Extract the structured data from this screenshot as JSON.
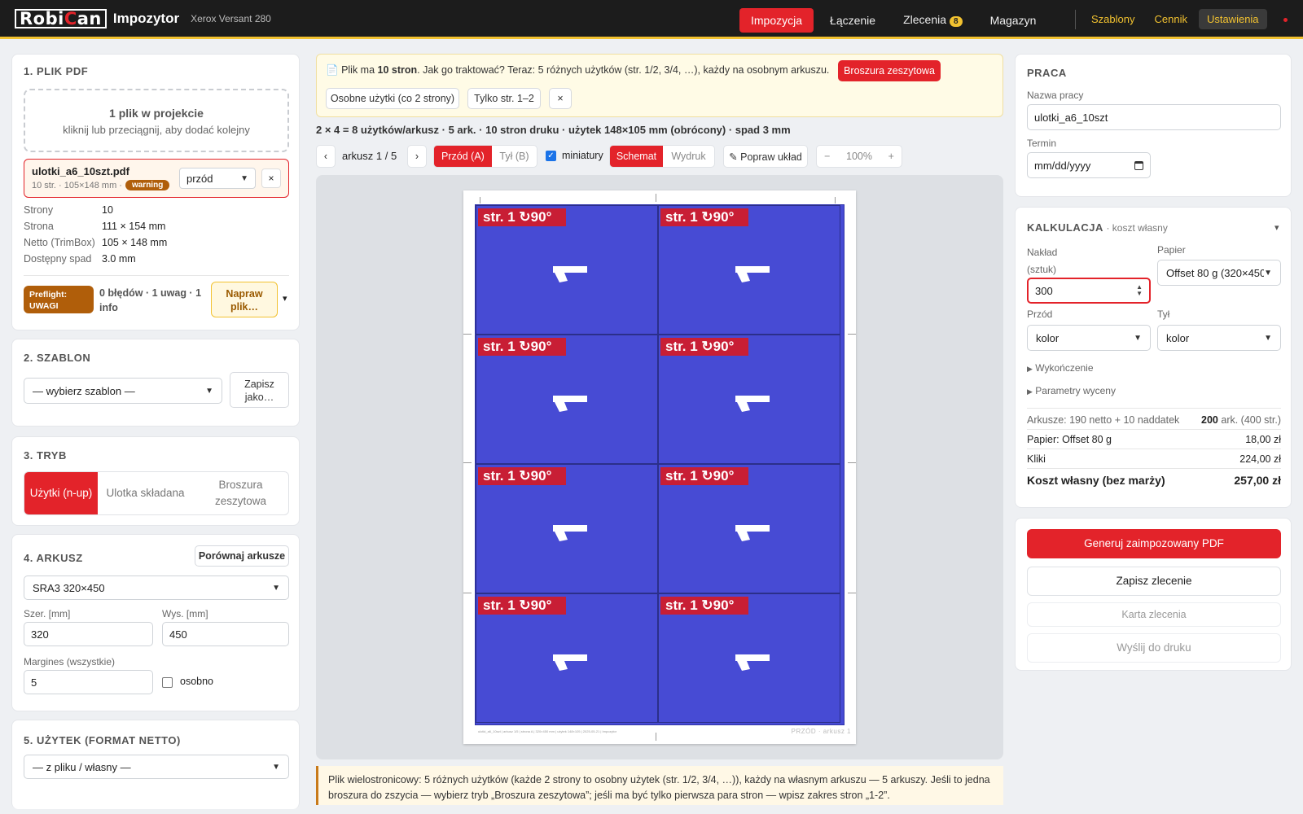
{
  "topbar": {
    "logo_a": "Robi",
    "logo_b": "C",
    "logo_c": "an",
    "app_name": "Impozytor",
    "device": "Xerox Versant 280",
    "nav": [
      {
        "label": "Impozycja",
        "active": true
      },
      {
        "label": "Łączenie"
      },
      {
        "label": "Zlecenia",
        "badge": "8"
      },
      {
        "label": "Magazyn"
      }
    ],
    "links": [
      "Szablony",
      "Cennik",
      "Ustawienia"
    ]
  },
  "plik": {
    "title": "1. PLIK PDF",
    "drop_line1": "1 plik w projekcie",
    "drop_line2": "kliknij lub przeciągnij, aby dodać kolejny",
    "file_name": "ulotki_a6_10szt.pdf",
    "file_meta": "10 str. · 105×148 mm ·",
    "file_badge": "warning",
    "side": "przód",
    "remove": "×",
    "props": [
      {
        "k": "Strony",
        "v": "10"
      },
      {
        "k": "Strona",
        "v": "111 × 154 mm"
      },
      {
        "k": "Netto (TrimBox)",
        "v": "105 × 148 mm"
      },
      {
        "k": "Dostępny spad",
        "v": "3.0 mm"
      }
    ],
    "preflight_badge": "Preflight: UWAGI",
    "preflight_text": "0 błędów · 1 uwag · 1 info",
    "fix_button": "Napraw plik…",
    "expand": "▾"
  },
  "szablon": {
    "title": "2. SZABLON",
    "select": "— wybierz szablon —",
    "save_as": "Zapisz jako…"
  },
  "tryb": {
    "title": "3. TRYB",
    "options": [
      "Użytki (n-up)",
      "Ulotka składana",
      "Broszura zeszytowa"
    ]
  },
  "arkusz": {
    "title": "4. ARKUSZ",
    "compare": "Porównaj arkusze",
    "select": "SRA3 320×450",
    "width_label": "Szer. [mm]",
    "width": "320",
    "height_label": "Wys. [mm]",
    "height": "450",
    "margins_label": "Margines (wszystkie)",
    "margins": "5",
    "separately": "osobno"
  },
  "uzytek": {
    "title": "5. UŻYTEK (FORMAT NETTO)",
    "select": "— z pliku / własny —"
  },
  "banner": {
    "icon": "📄",
    "text_a": "Plik ma ",
    "text_b": "10 stron",
    "text_c": ". Jak go traktować? Teraz: 5 różnych użytków (str. 1/2, 3/4, …), każdy na osobnym arkuszu.",
    "btn_booklet": "Broszura zeszytowa",
    "btn_separate": "Osobne użytki (co 2 strony)",
    "btn_only12": "Tylko str. 1–2",
    "btn_close": "×"
  },
  "summary": "2 × 4 = 8 użytków/arkusz · 5 ark. · 10 stron druku · użytek 148×105 mm (obrócony) · spad 3 mm",
  "toolbar": {
    "prev": "‹",
    "sheet": "arkusz 1 / 5",
    "next": "›",
    "front": "Przód (A)",
    "back": "Tył (B)",
    "thumbs": "miniatury",
    "schema": "Schemat",
    "print": "Wydruk",
    "fix_layout": "✎ Popraw układ",
    "zoom_out": "−",
    "zoom": "100%",
    "zoom_in": "+"
  },
  "preview": {
    "tile_label": "str. 1 ↻90°",
    "sheet_footer": "ulotki_a6_10szt | arkusz 1/5 | strona A | 320×450 mm | użytek 148×105 | 2025-05-21 | Impozytor",
    "sheet_side": "PRZÓD · arkusz 1",
    "sheet_color": "#474bd4",
    "label_color": "#c81e35"
  },
  "note": "Plik wielostronicowy: 5 różnych użytków (każde 2 strony to osobny użytek (str. 1/2, 3/4, …)), każdy na własnym arkuszu — 5 arkuszy. Jeśli to jedna broszura do zszycia — wybierz tryb „Broszura zeszytowa”; jeśli ma być tylko pierwsza para stron — wpisz zakres stron „1-2”.",
  "praca": {
    "title": "PRACA",
    "name_label": "Nazwa pracy",
    "name": "ulotki_a6_10szt",
    "date_label": "Termin",
    "date_placeholder": "mm/dd/yyyy"
  },
  "kalkulacja": {
    "title": "KALKULACJA",
    "subtitle": "· koszt własny",
    "toggle": "▾",
    "qty_label_a": "Nakład",
    "qty_label_b": "(sztuk)",
    "qty": "300",
    "paper_label": "Papier",
    "paper": "Offset 80 g (320×450)",
    "front_label": "Przód",
    "front": "kolor",
    "back_label": "Tył",
    "back": "kolor",
    "finishing": "Wykończenie",
    "pricing": "Parametry wyceny",
    "rows": [
      {
        "k": "Arkusze: 190 netto + 10 naddatek",
        "v_bold": "200",
        "v": " ark. (400 str.)"
      },
      {
        "k": "Papier: Offset 80 g",
        "v": "18,00 zł"
      },
      {
        "k": "Kliki",
        "v": "224,00 zł"
      }
    ],
    "total_label": "Koszt własny (bez marży)",
    "total": "257,00 zł"
  },
  "actions": {
    "generate": "Generuj zaimpozowany PDF",
    "save": "Zapisz zlecenie",
    "card": "Karta zlecenia",
    "send": "Wyślij do druku"
  },
  "colors": {
    "accent": "#e3232a",
    "topbar": "#1c1c1c",
    "highlight": "#f2c230"
  }
}
